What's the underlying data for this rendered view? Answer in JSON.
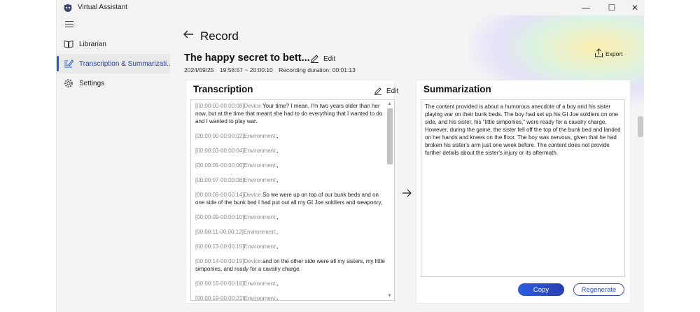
{
  "window": {
    "title": "Virtual Assistant",
    "controls": {
      "minimize": "—",
      "maximize": "☐",
      "close": "✕"
    }
  },
  "sidebar": {
    "items": [
      {
        "label": "Librarian",
        "icon": "book-icon"
      },
      {
        "label": "Transcription & Summarizati...",
        "icon": "transcribe-icon",
        "active": true
      },
      {
        "label": "Settings",
        "icon": "gear-icon"
      }
    ]
  },
  "header": {
    "title": "Record",
    "doc_title": "The happy secret to bett...",
    "edit_label": "Edit",
    "date": "2024/09/25",
    "time_range": "19:58:57  ~ 20:00:10",
    "duration": "Recording duration: 00:01:13",
    "export_label": "Export"
  },
  "transcription": {
    "title": "Transcription",
    "edit_label": "Edit",
    "segments": [
      {
        "ts": "[00:00:00-00:00:08]",
        "speaker": "Device:",
        "text": "Your time? I mean, I'm two years older than her now, but at the time that meant she had to do everything that I wanted to do and I wanted to play war."
      },
      {
        "ts": "[00:00:00-00:00:02]",
        "speaker": "Environment:",
        "text": ","
      },
      {
        "ts": "[00:00:03-00:00:04]",
        "speaker": "Environment:",
        "text": ","
      },
      {
        "ts": "[00:00:05-00:00:06]",
        "speaker": "Environment:",
        "text": ","
      },
      {
        "ts": "[00:00:07-00:00:08]",
        "speaker": "Environment:",
        "text": ","
      },
      {
        "ts": "[00:00:08-00:00:14]",
        "speaker": "Device:",
        "text": "So we were up on top of our bunk beds and on one side of the bunk bed I had put out all my GI Joe soldiers and weaponry,"
      },
      {
        "ts": "[00:00:09-00:00:10]",
        "speaker": "Environment:",
        "text": ","
      },
      {
        "ts": "[00:00:11-00:00:12]",
        "speaker": "Environment:",
        "text": ","
      },
      {
        "ts": "[00:00:13-00:00:15]",
        "speaker": "Environment:",
        "text": ","
      },
      {
        "ts": "[00:00:14-00:00:19]",
        "speaker": "Device:",
        "text": "and on the other side were all my sisters, my little simponies, and ready for a cavalry charge."
      },
      {
        "ts": "[00:00:16-00:00:18]",
        "speaker": "Environment:",
        "text": ","
      },
      {
        "ts": "[00:00:19-00:00:21]",
        "speaker": "Environment:",
        "text": ","
      }
    ]
  },
  "summarization": {
    "title": "Summarization",
    "text": "The content provided is about a humorous anecdote of a boy and his sister playing war on their bunk beds. The boy had set up his GI Joe soldiers on one side, and his sister, his \"little simponies,\" were ready for a cavalry charge. However, during the game, the sister fell off the top of the bunk bed and landed on her hands and knees on the floor. The boy was nervous, given that he had broken his sister's arm just one week before. The content does not provide further details about the sister's injury or its aftermath.",
    "copy_label": "Copy",
    "regenerate_label": "Regenerate"
  }
}
